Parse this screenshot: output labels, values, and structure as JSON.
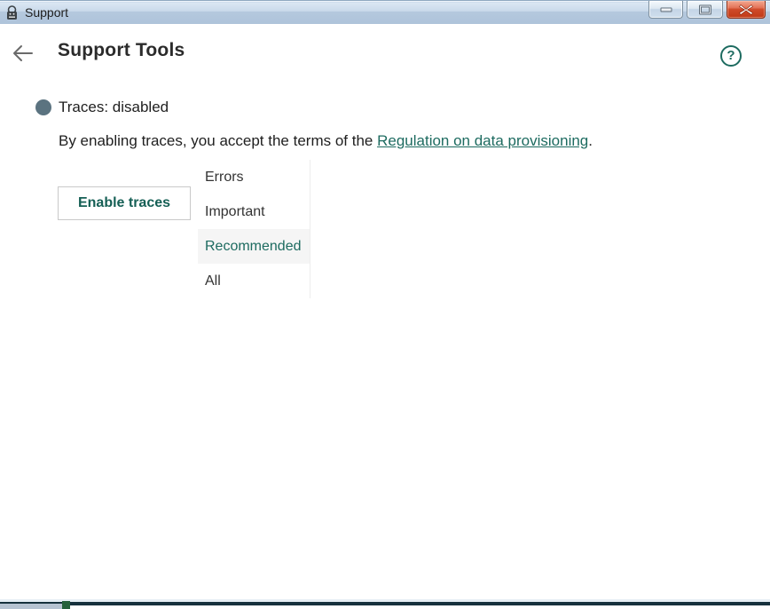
{
  "window": {
    "title": "Support"
  },
  "header": {
    "title": "Support Tools"
  },
  "status": {
    "label": "Traces: disabled"
  },
  "description": {
    "prefix": "By enabling traces, you accept the terms of the ",
    "link": "Regulation on data provisioning",
    "suffix": "."
  },
  "actions": {
    "enable_traces": "Enable traces"
  },
  "trace_levels": {
    "items": [
      "Errors",
      "Important",
      "Recommended",
      "All"
    ],
    "selected": "Recommended"
  },
  "icons": {
    "app": "app-icon",
    "back": "back-arrow-icon",
    "help": "help-question-icon",
    "minimize": "minimize-icon",
    "maximize": "maximize-icon",
    "close": "close-icon"
  },
  "colors": {
    "accent_teal": "#1d6b60",
    "status_dot_gray": "#5b7380",
    "titlebar_blue": "#c9d9ea",
    "close_red": "#c03a17",
    "selected_bg": "#f5f5f5",
    "bottom_bar": "#16313d"
  }
}
